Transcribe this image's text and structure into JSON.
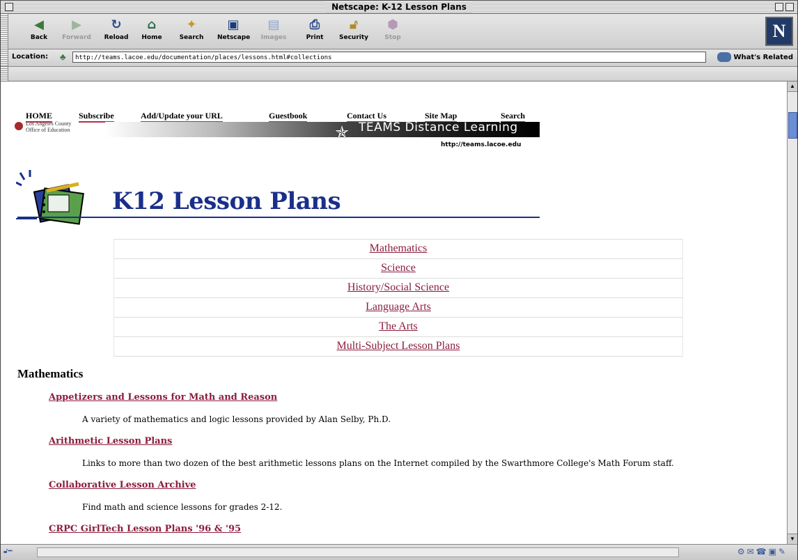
{
  "window": {
    "title": "Netscape: K-12 Lesson Plans"
  },
  "toolbar": {
    "buttons": [
      {
        "label": "Back"
      },
      {
        "label": "Forward"
      },
      {
        "label": "Reload"
      },
      {
        "label": "Home"
      },
      {
        "label": "Search"
      },
      {
        "label": "Netscape"
      },
      {
        "label": "Images"
      },
      {
        "label": "Print"
      },
      {
        "label": "Security"
      },
      {
        "label": "Stop"
      }
    ]
  },
  "location": {
    "label": "Location:",
    "url": "http://teams.lacoe.edu/documentation/places/lessons.html#collections",
    "related": "What's Related"
  },
  "page": {
    "topnav": [
      "HOME",
      "Subscribe",
      "Add/Update your URL",
      "Guestbook",
      "Contact Us",
      "Site Map",
      "Search"
    ],
    "org_line1": "Los Angeles County",
    "org_line2": "Office of Education",
    "banner_title": "TEAMS Distance Learning",
    "banner_url": "http://teams.lacoe.edu",
    "heading": "K12 Lesson Plans",
    "subjects": [
      "Mathematics",
      "Science",
      "History/Social Science",
      "Language Arts",
      "The Arts",
      "Multi-Subject Lesson Plans"
    ],
    "section_title": "Mathematics",
    "entries": [
      {
        "link": "Appetizers and Lessons for Math and Reason",
        "desc": "A variety of mathematics and logic lessons provided by Alan Selby, Ph.D."
      },
      {
        "link": "Arithmetic Lesson Plans",
        "desc": "Links to more than two dozen of the best arithmetic lessons plans on the Internet compiled by the Swarthmore College's Math Forum staff."
      },
      {
        "link": "Collaborative Lesson Archive",
        "desc": "Find math and science lessons for grades 2-12."
      },
      {
        "link": "CRPC GirlTech Lesson Plans '96 & '95",
        "desc": ""
      }
    ]
  }
}
